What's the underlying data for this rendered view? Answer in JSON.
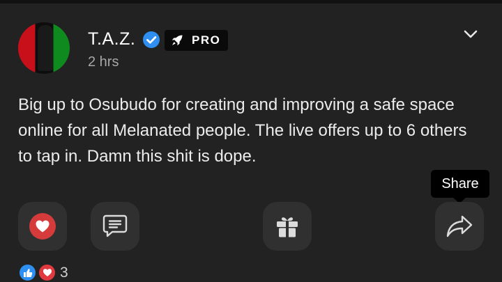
{
  "post": {
    "author_name": "T.A.Z.",
    "badge_label": "PRO",
    "timestamp": "2 hrs",
    "body": "Big up to Osubudo for creating and improving a safe space online for all Melanated people. The live offers up to 6 others to tap in. Damn this shit is dope."
  },
  "actions": {
    "like_icon": "heart-icon",
    "comment_icon": "comment-icon",
    "gift_icon": "gift-icon",
    "share_icon": "share-icon"
  },
  "tooltip": {
    "label": "Share"
  },
  "reactions": {
    "count": "3"
  },
  "colors": {
    "background": "#222222",
    "button_bg": "#303030",
    "like_red": "#d63b3b",
    "verified_blue": "#2f8ff0"
  }
}
